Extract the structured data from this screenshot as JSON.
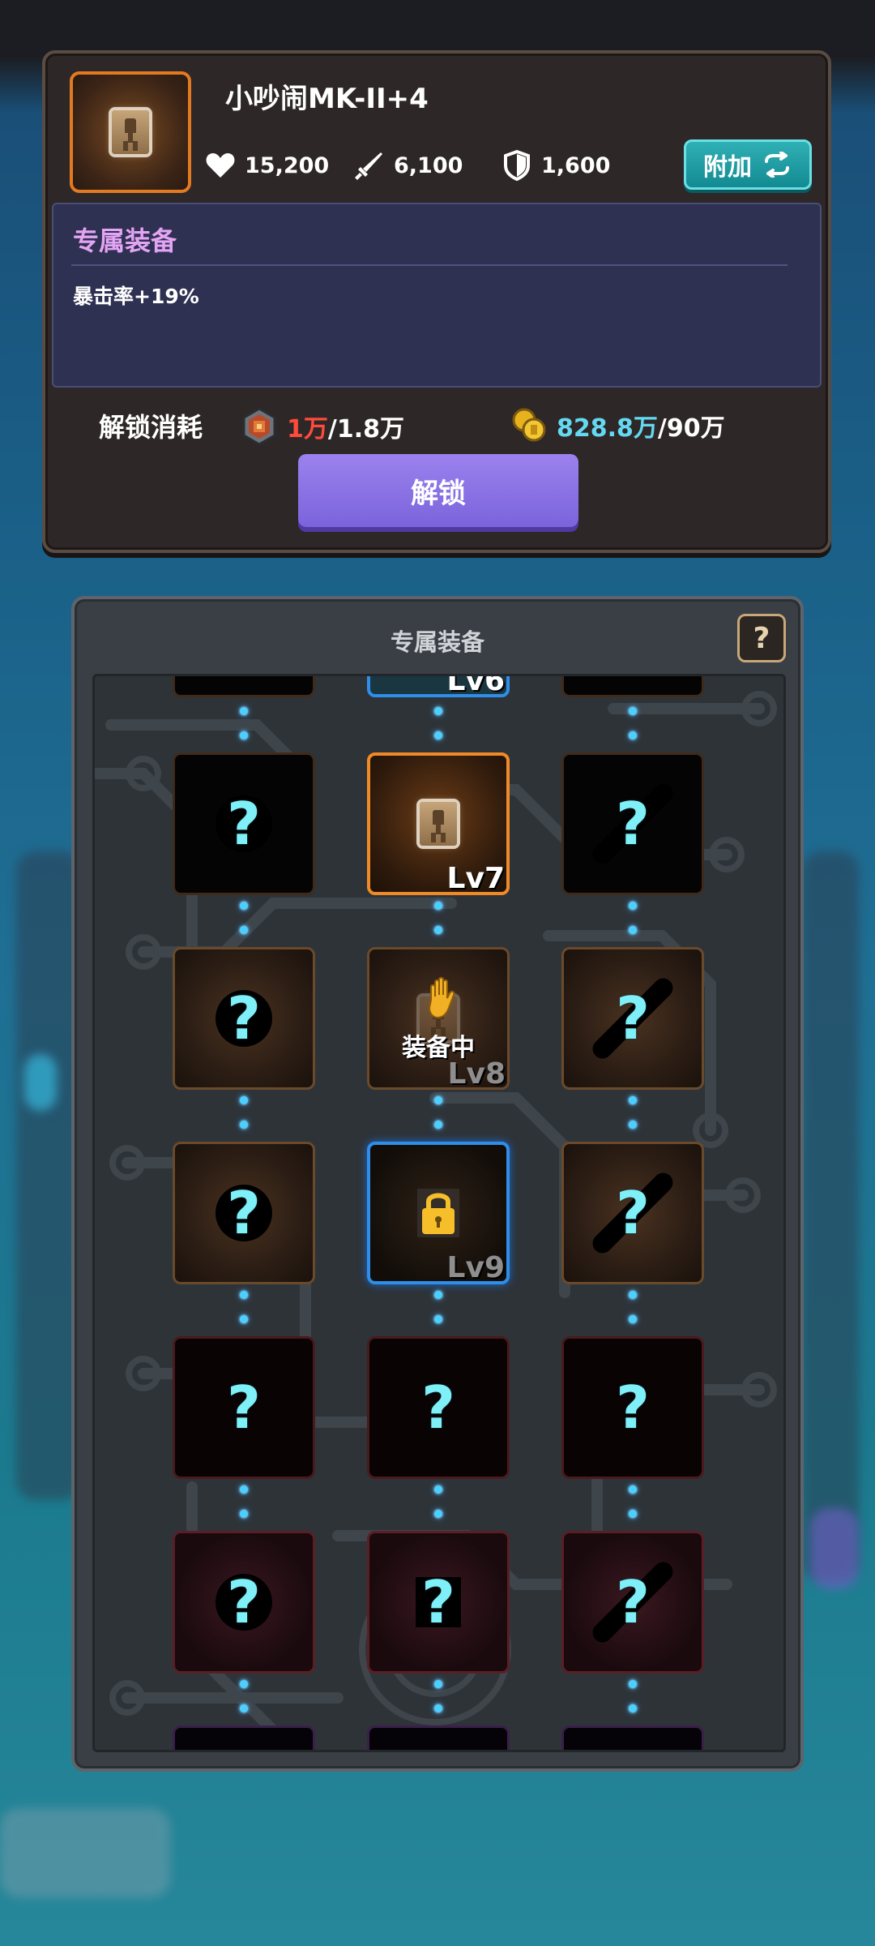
{
  "item": {
    "name": "小吵闹MK-II+4",
    "hp": "15,200",
    "atk": "6,100",
    "def": "1,600",
    "append_label": "附加"
  },
  "exclusive": {
    "title": "专属装备",
    "stat": "暴击率+19%"
  },
  "unlock_cost": {
    "label": "解锁消耗",
    "material_have": "1万",
    "material_need": "/1.8万",
    "gold_have": "828.8万",
    "gold_need": "/90万"
  },
  "unlock_button": "解锁",
  "grid": {
    "title": "专属装备",
    "help": "?",
    "equipped_label": "装备中",
    "levels": {
      "lv6": "Lv6",
      "lv7": "Lv7",
      "lv8": "Lv8",
      "lv9": "Lv9"
    },
    "unknown": "?"
  },
  "colors": {
    "accent_orange": "#f08a28",
    "accent_teal": "#2fb0b4",
    "unlock_purple": "#8b72e6",
    "question_cyan": "#7ff0f8",
    "cost_red": "#ff4b3b",
    "cost_cyan": "#64d9f2"
  }
}
